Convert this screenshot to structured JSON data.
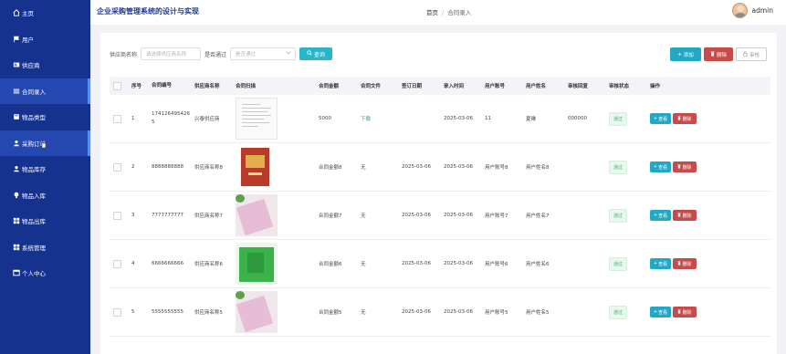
{
  "header": {
    "site_title": "企业采购管理系统的设计与实现",
    "breadcrumb_home": "首页",
    "breadcrumb_sep": "/",
    "breadcrumb_current": "合同录入",
    "username": "admin"
  },
  "sidebar": {
    "items": [
      {
        "label": "主页",
        "icon": "home-icon"
      },
      {
        "label": "用户",
        "icon": "flag-icon"
      },
      {
        "label": "供应商",
        "icon": "card-icon"
      },
      {
        "label": "合同录入",
        "icon": "list-icon",
        "active": true
      },
      {
        "label": "物品类型",
        "icon": "box-icon"
      },
      {
        "label": "采购订单",
        "icon": "user-icon"
      },
      {
        "label": "物品库存",
        "icon": "user-icon"
      },
      {
        "label": "物品入库",
        "icon": "bulb-icon"
      },
      {
        "label": "物品出库",
        "icon": "grid-icon"
      },
      {
        "label": "系统管理",
        "icon": "grid-icon"
      },
      {
        "label": "个人中心",
        "icon": "window-icon"
      }
    ]
  },
  "search": {
    "supplier_label": "供应商名称",
    "supplier_placeholder": "请选择供应商名称",
    "approve_label": "是否通过",
    "approve_placeholder": "是否通过",
    "query_button": "查询"
  },
  "actions": {
    "add": "添加",
    "delete": "删除",
    "review": "审核"
  },
  "table": {
    "columns": [
      "序号",
      "合同编号",
      "供应商名称",
      "合同扫描",
      "合同金额",
      "合同文件",
      "签订日期",
      "录入时间",
      "用户账号",
      "用户姓名",
      "审核回复",
      "审核状态",
      "操作"
    ],
    "view_label": "查看",
    "delete_label": "删除",
    "rows": [
      {
        "no": "1",
        "code": "1741264954265",
        "supplier": "兴泰供应商",
        "amount": "5000",
        "file": "下载",
        "file_link": true,
        "sign_date": "",
        "entry_time": "2025-03-06",
        "account": "11",
        "user_name": "夏琳",
        "reply": "000000",
        "status": "通过",
        "thumb": "doc"
      },
      {
        "no": "2",
        "code": "8888888888",
        "supplier": "供应商名称8",
        "amount": "合同金额8",
        "file": "无",
        "file_link": false,
        "sign_date": "2025-03-06",
        "entry_time": "2025-03-06",
        "account": "用户账号8",
        "user_name": "用户姓名8",
        "reply": "",
        "status": "通过",
        "thumb": "red"
      },
      {
        "no": "3",
        "code": "7777777777",
        "supplier": "供应商名称7",
        "amount": "合同金额7",
        "file": "无",
        "file_link": false,
        "sign_date": "2025-03-06",
        "entry_time": "2025-03-06",
        "account": "用户账号7",
        "user_name": "用户姓名7",
        "reply": "",
        "status": "通过",
        "thumb": "pink"
      },
      {
        "no": "4",
        "code": "6666666666",
        "supplier": "供应商名称6",
        "amount": "合同金额6",
        "file": "无",
        "file_link": false,
        "sign_date": "2025-03-06",
        "entry_time": "2025-03-06",
        "account": "用户账号6",
        "user_name": "用户姓名6",
        "reply": "",
        "status": "通过",
        "thumb": "green"
      },
      {
        "no": "5",
        "code": "5555555555",
        "supplier": "供应商名称5",
        "amount": "合同金额5",
        "file": "无",
        "file_link": false,
        "sign_date": "2025-03-06",
        "entry_time": "2025-03-06",
        "account": "用户账号5",
        "user_name": "用户姓名5",
        "reply": "",
        "status": "通过",
        "thumb": "pink"
      }
    ]
  },
  "colors": {
    "sidebar_bg": "#16328f",
    "accent": "#22a8c4",
    "danger": "#c64b4b",
    "success": "#4caf72"
  }
}
